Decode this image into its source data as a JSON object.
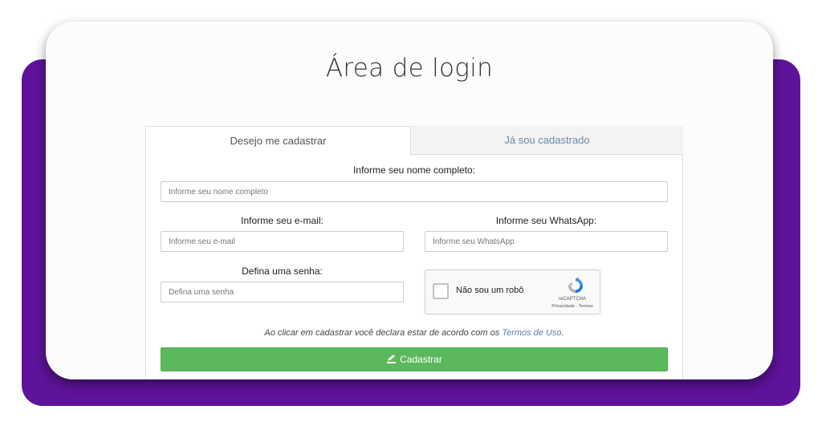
{
  "page": {
    "title": "Área de login"
  },
  "tabs": [
    {
      "label": "Desejo me cadastrar",
      "active": true
    },
    {
      "label": "Já sou cadastrado",
      "active": false
    }
  ],
  "form": {
    "name_label": "Informe seu nome completo:",
    "name_placeholder": "Informe seu nome completo",
    "email_label": "Informe seu e-mail:",
    "email_placeholder": "Informe seu e-mail",
    "whatsapp_label": "Informe seu WhatsApp:",
    "whatsapp_placeholder": "Informe seu WhatsApp",
    "password_label": "Defina uma senha:",
    "password_placeholder": "Defina uma senha",
    "terms_prefix": "Ao clicar em cadastrar você declara estar de acordo com os ",
    "terms_link": "Termos de Uso",
    "terms_suffix": ".",
    "submit_label": "Cadastrar",
    "submit_icon": "edit-icon"
  },
  "recaptcha": {
    "label": "Não sou um robô",
    "brand": "reCAPTCHA",
    "links": "Privacidade - Termos",
    "icon": "recaptcha-logo-icon"
  },
  "colors": {
    "backdrop": "#5e139b",
    "submit": "#5cb85c",
    "link": "#5a80a8"
  }
}
